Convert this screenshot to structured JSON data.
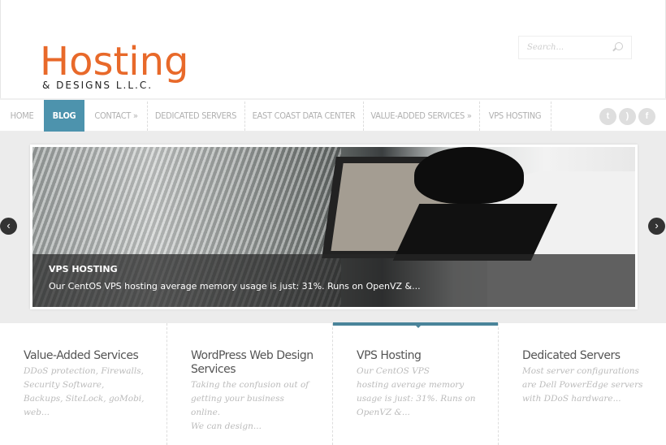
{
  "brand": {
    "logo_main": "Hosting",
    "logo_sub": "& DESIGNS L.L.C.",
    "accent": "#e8692a"
  },
  "search": {
    "placeholder": "Search..."
  },
  "nav": {
    "items": [
      "HOME",
      "BLOG",
      "CONTACT »",
      "DEDICATED SERVERS",
      "EAST COAST DATA CENTER",
      "VALUE-ADDED SERVICES »",
      "VPS HOSTING"
    ],
    "active": "BLOG",
    "active_color": "#4d93ad"
  },
  "social": [
    "twitter-icon",
    "rss-icon",
    "facebook-icon"
  ],
  "slider": {
    "title": "VPS HOSTING",
    "text": "Our CentOS VPS hosting average memory usage is just: 31%. Runs on OpenVZ &...",
    "prev": "‹",
    "next": "›"
  },
  "features": [
    {
      "title": "Value-Added Services",
      "text": "DDoS protection, Firewalls, Security Software, Backups, SiteLock, goMobi, web..."
    },
    {
      "title": "WordPress Web Design Services",
      "text": "Taking the confusion out of getting your business online.\n  We can design..."
    },
    {
      "title": "VPS Hosting",
      "text": "Our CentOS VPS\nhosting average memory usage is just: 31%. Runs on OpenVZ &..."
    },
    {
      "title": "Dedicated Servers",
      "text": "Most server configurations are Dell PowerEdge servers with DDoS hardware..."
    }
  ]
}
